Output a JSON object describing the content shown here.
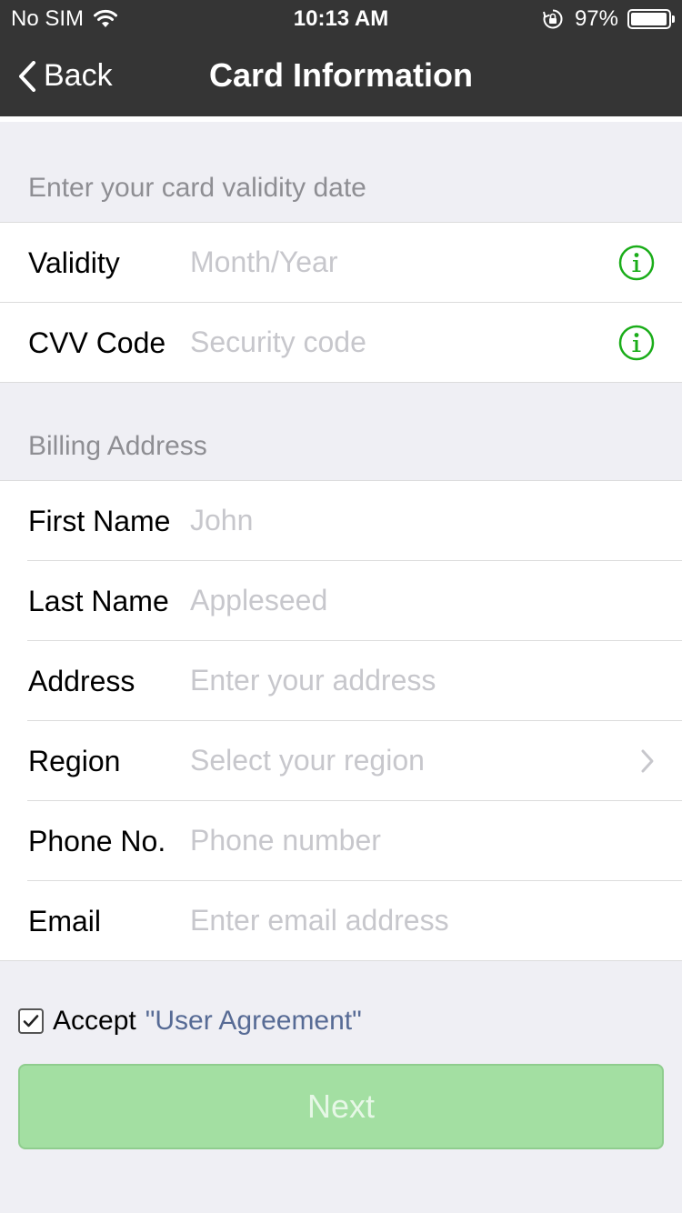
{
  "status_bar": {
    "carrier": "No SIM",
    "time": "10:13 AM",
    "battery_percent": "97%",
    "battery_level": 0.97,
    "icons": [
      "wifi-icon",
      "rotation-lock-icon",
      "battery-icon"
    ]
  },
  "nav": {
    "back_label": "Back",
    "title": "Card Information",
    "background": "#353535"
  },
  "validity_section": {
    "title": "Enter your card validity date",
    "rows": [
      {
        "label": "Validity",
        "placeholder": "Month/Year",
        "icon": "info-icon"
      },
      {
        "label": "CVV Code",
        "placeholder": "Security code",
        "icon": "info-icon"
      }
    ]
  },
  "billing_section": {
    "title": "Billing Address",
    "rows": [
      {
        "label": "First Name",
        "placeholder": "John"
      },
      {
        "label": "Last Name",
        "placeholder": "Appleseed"
      },
      {
        "label": "Address",
        "placeholder": "Enter your address"
      },
      {
        "label": "Region",
        "placeholder": "Select your region",
        "icon": "chevron-right-icon"
      },
      {
        "label": "Phone No.",
        "placeholder": "Phone number"
      },
      {
        "label": "Email",
        "placeholder": "Enter email address"
      }
    ]
  },
  "agreement": {
    "checked": true,
    "accept_label": "Accept",
    "link_label": "\"User Agreement\""
  },
  "next_button": {
    "label": "Next",
    "enabled": false
  },
  "colors": {
    "accent_green": "#1aad19",
    "link_blue": "#576b95",
    "disabled_button": "#a3dfa2"
  }
}
